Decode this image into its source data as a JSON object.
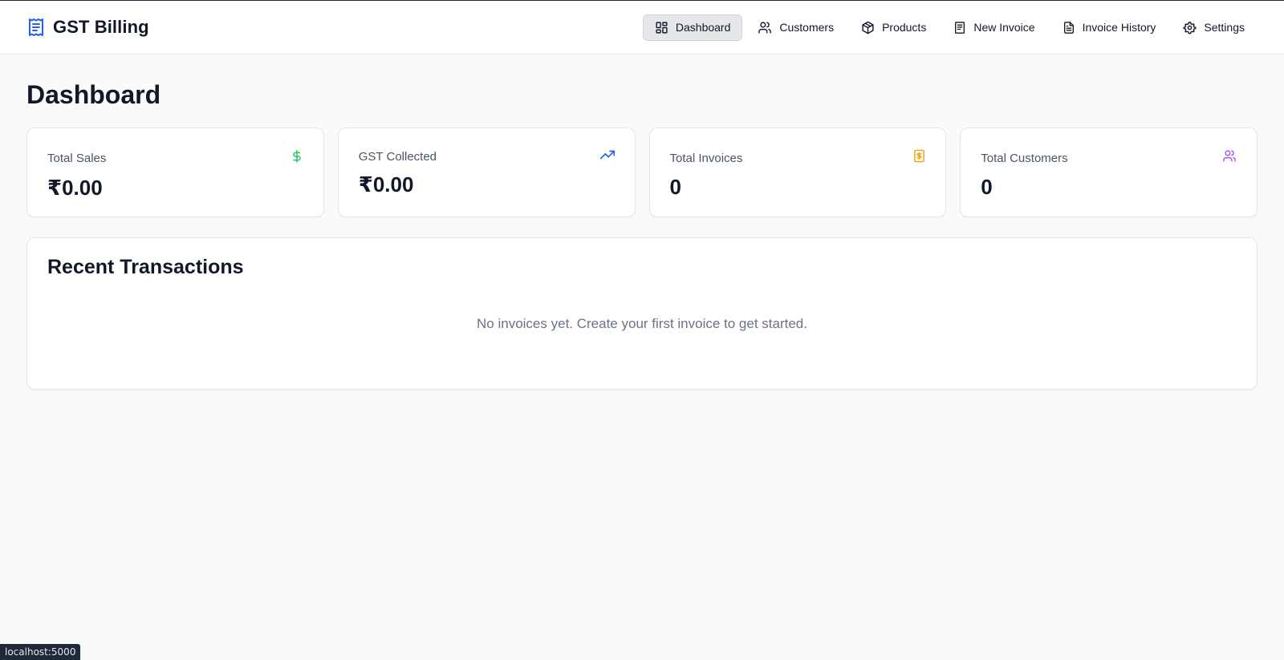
{
  "app": {
    "name": "GST Billing",
    "brand_color": "#2563eb"
  },
  "nav": {
    "items": [
      {
        "label": "Dashboard",
        "icon": "dashboard-icon",
        "active": true
      },
      {
        "label": "Customers",
        "icon": "users-icon"
      },
      {
        "label": "Products",
        "icon": "package-icon"
      },
      {
        "label": "New Invoice",
        "icon": "invoice-icon"
      },
      {
        "label": "Invoice History",
        "icon": "file-text-icon"
      },
      {
        "label": "Settings",
        "icon": "gear-icon"
      }
    ]
  },
  "page": {
    "title": "Dashboard"
  },
  "stats": [
    {
      "label": "Total Sales",
      "value": "₹0.00",
      "icon": "dollar-icon",
      "color": "#22c55e"
    },
    {
      "label": "GST Collected",
      "value": "₹0.00",
      "icon": "trending-up-icon",
      "color": "#2563eb"
    },
    {
      "label": "Total Invoices",
      "value": "0",
      "icon": "receipt-icon",
      "color": "#f59e0b"
    },
    {
      "label": "Total Customers",
      "value": "0",
      "icon": "users-icon",
      "color": "#a855f7"
    }
  ],
  "recent": {
    "title": "Recent Transactions",
    "empty_message": "No invoices yet. Create your first invoice to get started."
  },
  "status": {
    "url": "localhost:5000"
  }
}
